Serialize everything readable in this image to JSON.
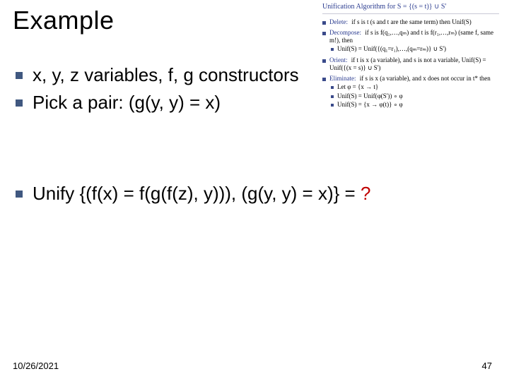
{
  "title": "Example",
  "bullets": {
    "b1": "x, y, z variables, f, g constructors",
    "b2": "Pick a pair: (g(y, y) = x)",
    "b3_prefix": "Unify {(f(x) = f(g(f(z), y))), (g(y, y) = x)} = ",
    "b3_suffix": "?"
  },
  "footer": {
    "date": "10/26/2021",
    "page": "47"
  },
  "ref": {
    "heading": "Unification Algorithm for S = {(s = t)} ∪ S'",
    "delete_label": "Delete:",
    "delete_body": "if s is t (s and t are the same term) then Unif(S)",
    "decompose_label": "Decompose:",
    "decompose_body": "if s is f(q₁,…,qₘ) and t is f(r₁,…,rₘ) (same f, same m!), then",
    "decompose_sub": "Unif(S) = Unif({(q₁=r₁),…,(qₘ=rₘ)} ∪ S')",
    "orient_label": "Orient:",
    "orient_body": "if t is x (a variable), and s is not a variable, Unif(S) = Unif({(x = s)} ∪ S')",
    "eliminate_label": "Eliminate:",
    "eliminate_body": "if s is x (a variable), and x does not occur in t* then",
    "elim_sub1": "Let φ = {x → t}",
    "elim_sub2": "Unif(S) = Unif(φ(S')) ∘ φ",
    "elim_sub3": "Unif(S) = {x → φ(t)} ∘ φ"
  }
}
